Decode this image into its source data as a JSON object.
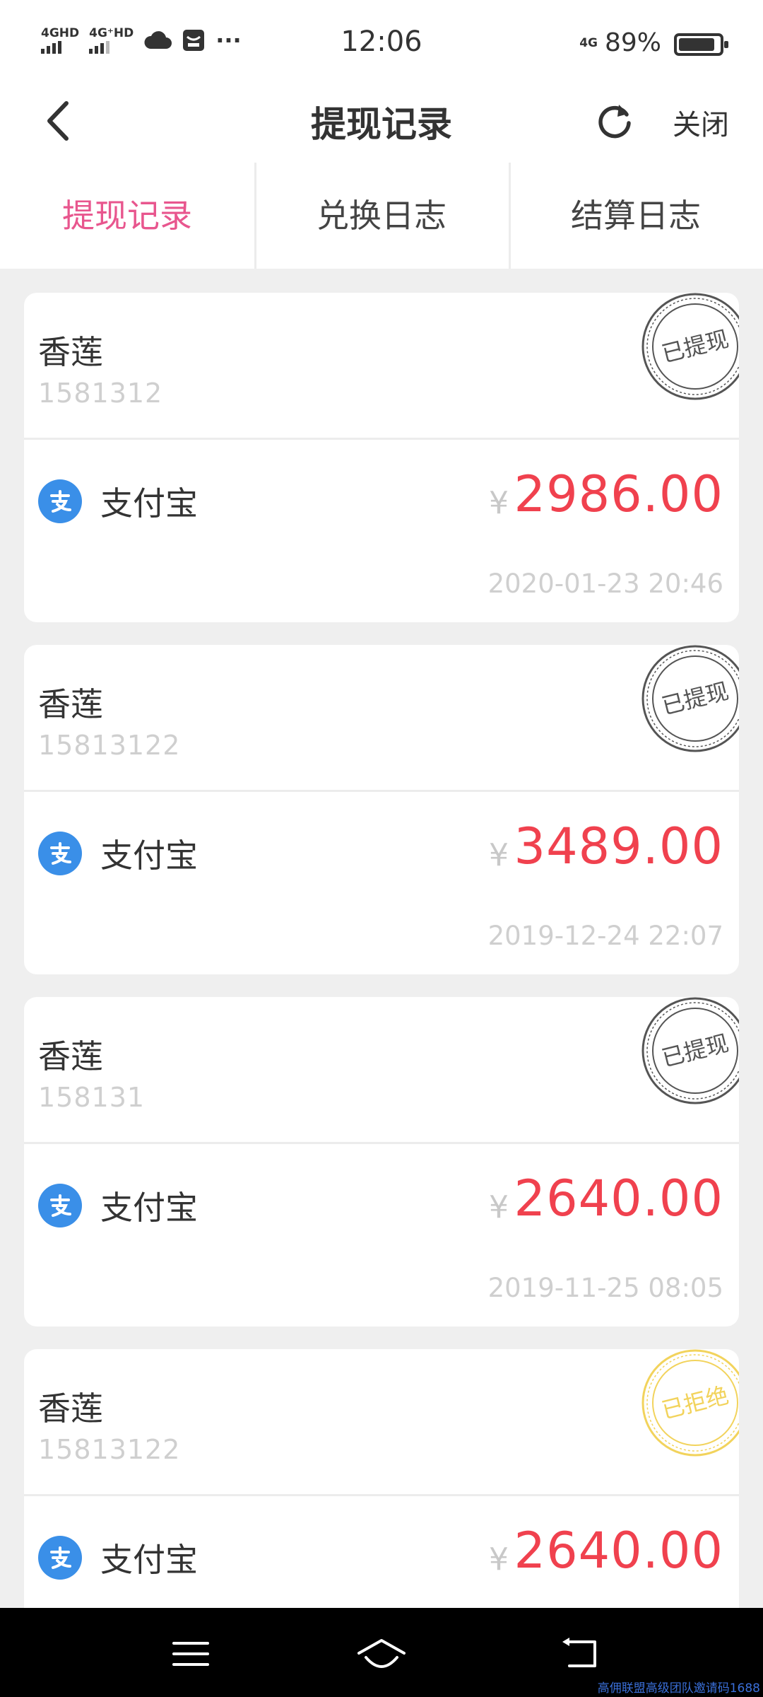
{
  "status_bar": {
    "signal_1": "4GHD",
    "signal_2": "4G⁺HD",
    "dots": "···",
    "time": "12:06",
    "net": "4G",
    "battery": "89%"
  },
  "nav": {
    "title": "提现记录",
    "close": "关闭"
  },
  "tabs": [
    {
      "label": "提现记录"
    },
    {
      "label": "兑换日志"
    },
    {
      "label": "结算日志"
    }
  ],
  "records": [
    {
      "name": "香莲",
      "account": "1581312",
      "stamp": "已提现",
      "method": "支付宝",
      "currency": "¥",
      "amount": "2986.00",
      "date": "2020-01-23 20:46"
    },
    {
      "name": "香莲",
      "account": "15813122",
      "stamp": "已提现",
      "method": "支付宝",
      "currency": "¥",
      "amount": "3489.00",
      "date": "2019-12-24 22:07"
    },
    {
      "name": "香莲",
      "account": "158131",
      "stamp": "已提现",
      "method": "支付宝",
      "currency": "¥",
      "amount": "2640.00",
      "date": "2019-11-25 08:05"
    },
    {
      "name": "香莲",
      "account": "15813122",
      "stamp": "已拒绝",
      "method": "支付宝",
      "currency": "¥",
      "amount": "2640.00",
      "date": ""
    }
  ],
  "colors": {
    "accent_pink": "#e8568e",
    "amount_red": "#f0414e",
    "stamp_done": "#555555",
    "stamp_rejected": "#f2d35c",
    "alipay_blue": "#3a8fe8"
  },
  "icons": {
    "back": "chevron-left-icon",
    "refresh": "refresh-icon",
    "payment": "alipay-icon",
    "nav_menu": "menu-icon",
    "nav_home": "home-icon",
    "nav_back": "back-icon"
  },
  "watermark": "高佣联盟高级团队邀请码1688"
}
